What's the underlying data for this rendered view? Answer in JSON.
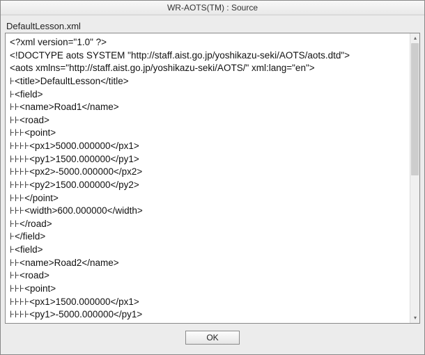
{
  "window": {
    "title": "WR-AOTS(TM) : Source"
  },
  "filename": "DefaultLesson.xml",
  "source_lines": [
    "<?xml version=\"1.0\" ?>",
    "<!DOCTYPE aots SYSTEM \"http://staff.aist.go.jp/yoshikazu-seki/AOTS/aots.dtd\">",
    "<aots xmlns=\"http://staff.aist.go.jp/yoshikazu-seki/AOTS/\" xml:lang=\"en\">",
    "⊦<title>DefaultLesson</title>",
    "⊦<field>",
    "⊦⊦<name>Road1</name>",
    "⊦⊦<road>",
    "⊦⊦⊦<point>",
    "⊦⊦⊦⊦<px1>5000.000000</px1>",
    "⊦⊦⊦⊦<py1>1500.000000</py1>",
    "⊦⊦⊦⊦<px2>-5000.000000</px2>",
    "⊦⊦⊦⊦<py2>1500.000000</py2>",
    "⊦⊦⊦</point>",
    "⊦⊦⊦<width>600.000000</width>",
    "⊦⊦</road>",
    "⊦</field>",
    "⊦<field>",
    "⊦⊦<name>Road2</name>",
    "⊦⊦<road>",
    "⊦⊦⊦<point>",
    "⊦⊦⊦⊦<px1>1500.000000</px1>",
    "⊦⊦⊦⊦<py1>-5000.000000</py1>"
  ],
  "buttons": {
    "ok": "OK"
  }
}
